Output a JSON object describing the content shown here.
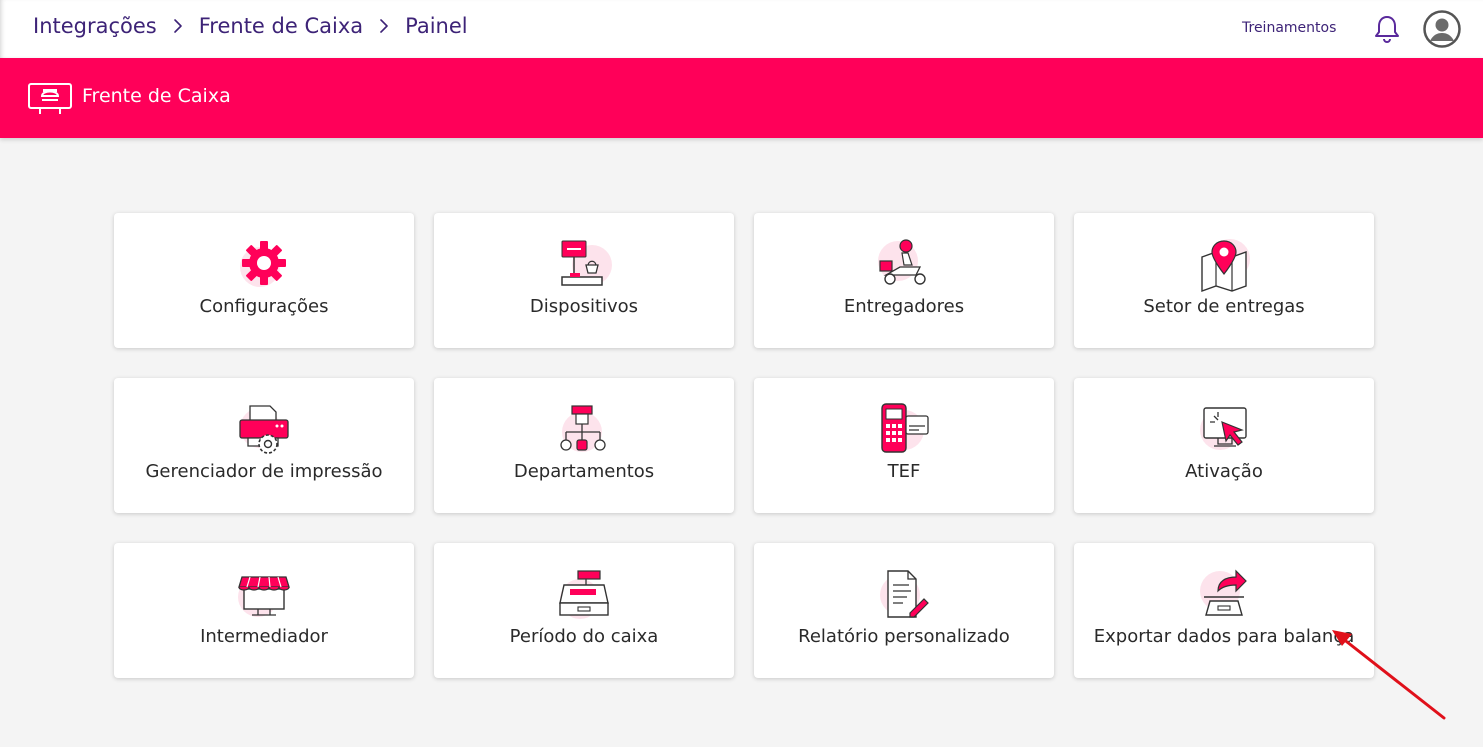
{
  "breadcrumb": {
    "items": [
      "Integrações",
      "Frente de Caixa",
      "Painel"
    ]
  },
  "header": {
    "treinamentos": "Treinamentos",
    "bell_icon": "bell-icon",
    "avatar_icon": "user-avatar-icon"
  },
  "banner": {
    "title": "Frente de Caixa",
    "logo_icon": "cash-register-logo-icon",
    "color": "#ff0059"
  },
  "cards": [
    {
      "label": "Configurações",
      "icon": "gear-icon"
    },
    {
      "label": "Dispositivos",
      "icon": "pdv-device-icon"
    },
    {
      "label": "Entregadores",
      "icon": "delivery-scooter-icon"
    },
    {
      "label": "Setor de entregas",
      "icon": "map-pin-icon"
    },
    {
      "label": "Gerenciador de impressão",
      "icon": "printer-settings-icon"
    },
    {
      "label": "Departamentos",
      "icon": "org-chart-icon"
    },
    {
      "label": "TEF",
      "icon": "card-terminal-icon"
    },
    {
      "label": "Ativação",
      "icon": "monitor-click-icon"
    },
    {
      "label": "Intermediador",
      "icon": "storefront-icon"
    },
    {
      "label": "Período do caixa",
      "icon": "cash-drawer-icon"
    },
    {
      "label": "Relatório personalizado",
      "icon": "report-edit-icon"
    },
    {
      "label": "Exportar dados para balança",
      "icon": "scale-export-icon"
    }
  ],
  "colors": {
    "accent": "#ff0059",
    "accent_light": "#fde3ec",
    "breadcrumb_text": "#3d2377",
    "annotation_arrow": "#e0101a"
  }
}
